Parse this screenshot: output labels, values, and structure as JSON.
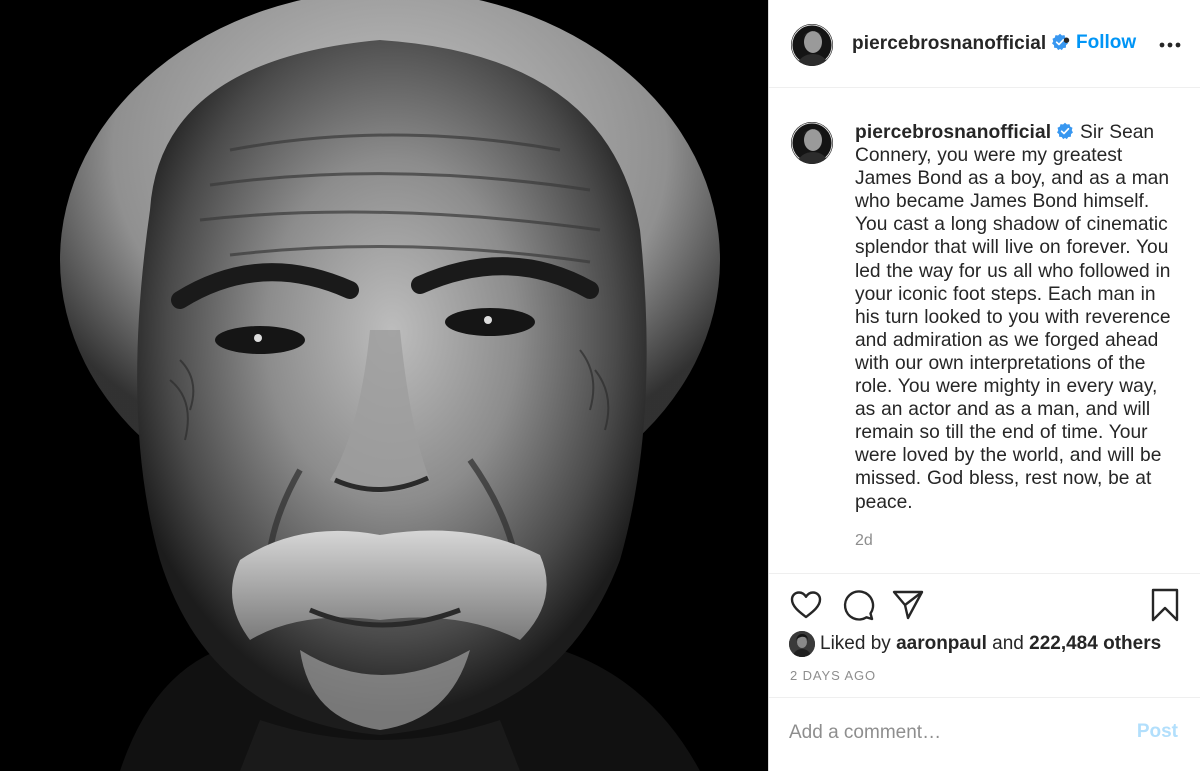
{
  "post": {
    "author": {
      "username": "piercebrosnanofficial",
      "verified": true
    },
    "header": {
      "separator": "•",
      "follow_label": "Follow",
      "more_icon": "more-options-icon"
    },
    "caption": {
      "username": "piercebrosnanofficial",
      "text": "Sir Sean Connery, you were my greatest James Bond as a boy, and as a man who became James Bond himself. You cast a long shadow of cinematic splendor that will live on forever. You led the way for us all who followed in your iconic foot steps. Each man in his turn looked to you with reverence and admiration as we forged ahead with our own interpretations of the role. You were mighty in every way, as an actor and as a man, and will remain so till the end of time. Your were loved by the world, and will be missed. God bless, rest now, be at peace.",
      "age": "2d"
    },
    "actions": {
      "like_icon": "heart-icon",
      "comment_icon": "comment-bubble-icon",
      "share_icon": "paper-plane-icon",
      "save_icon": "bookmark-icon"
    },
    "likes": {
      "prefix": "Liked by",
      "liker": "aaronpaul",
      "conjunction": "and",
      "others": "222,484 others"
    },
    "posted_ago": "2 DAYS AGO",
    "comment": {
      "placeholder": "Add a comment…",
      "post_label": "Post"
    },
    "colors": {
      "link_blue": "#0095f6",
      "verified_blue": "#3897f0",
      "post_disabled": "#b2dffc",
      "muted_text": "#8e8e8e"
    }
  }
}
